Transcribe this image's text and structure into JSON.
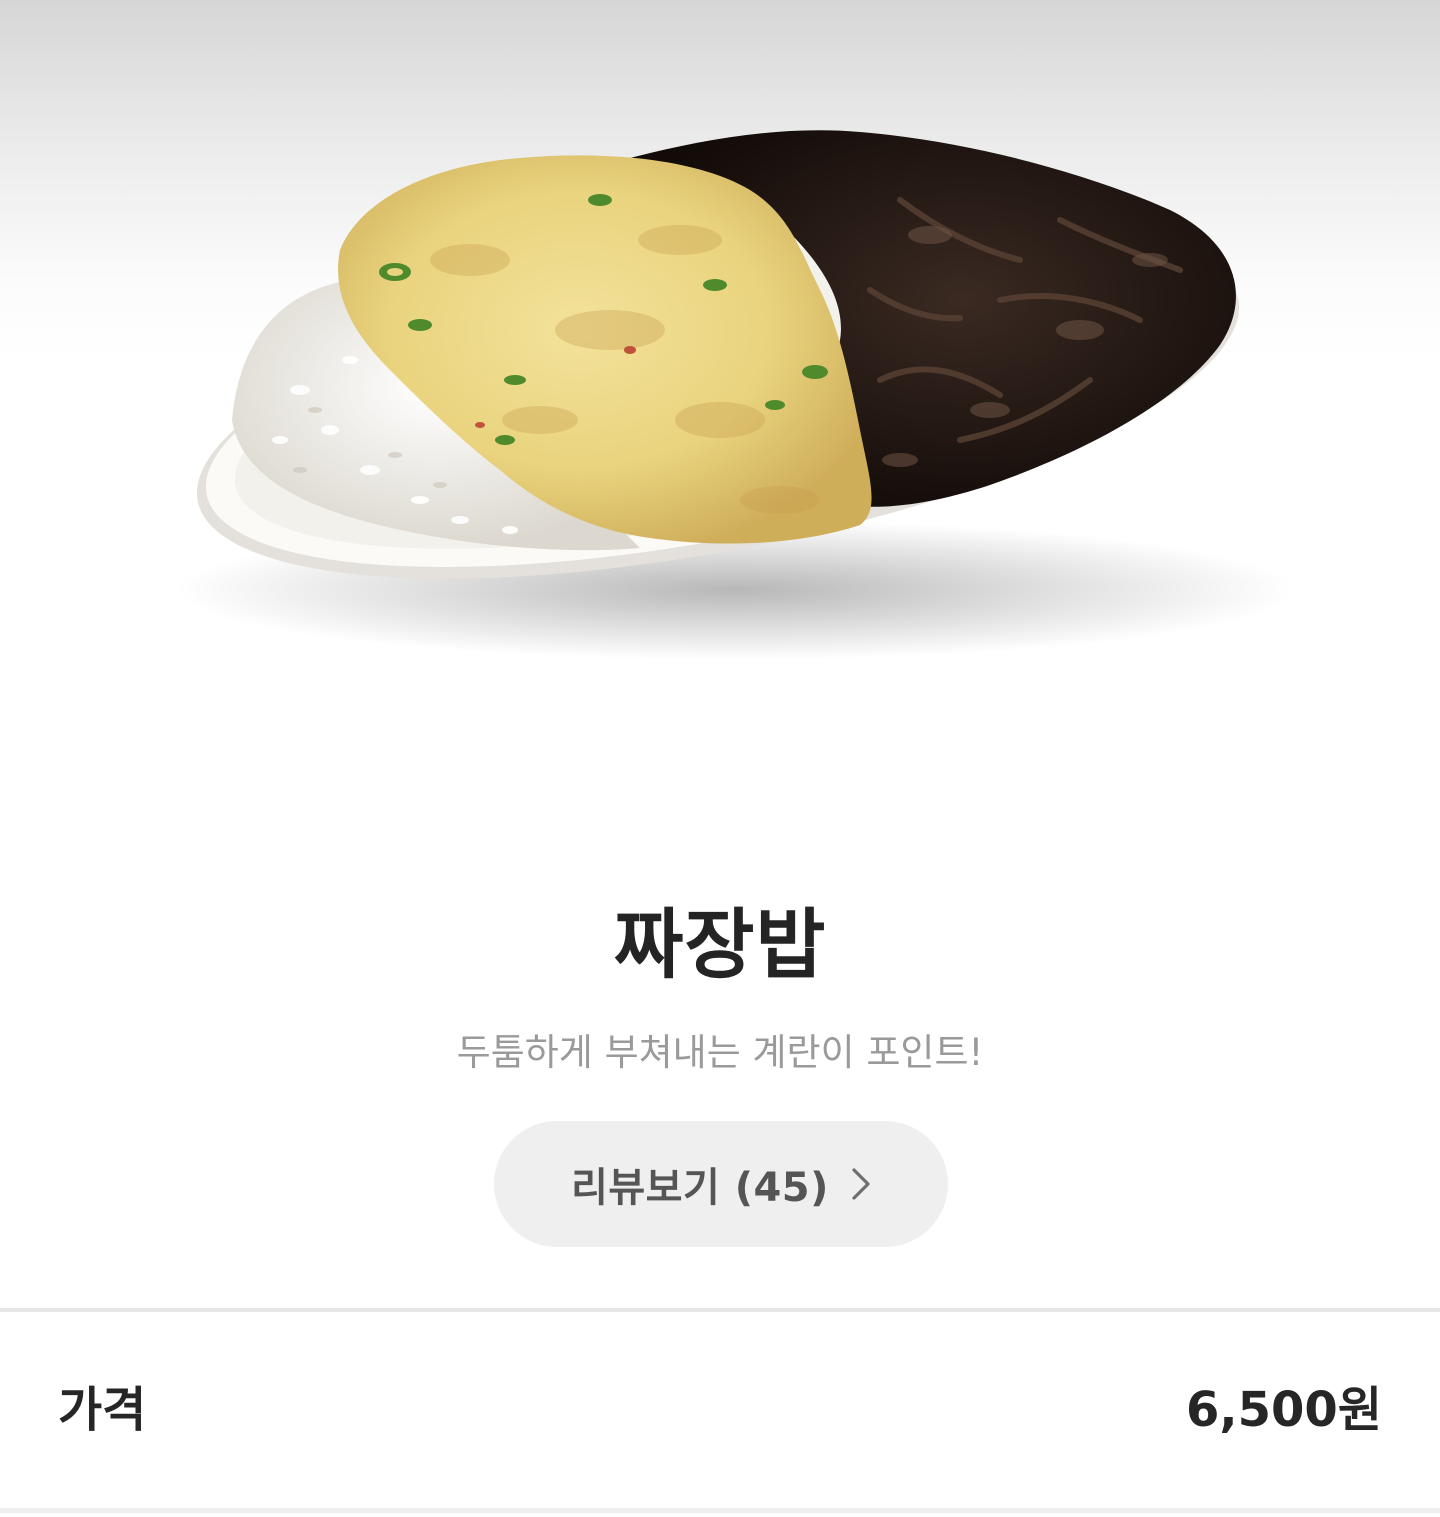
{
  "product": {
    "name": "짜장밥",
    "description": "두툼하게 부쳐내는 계란이 포인트!",
    "review_button_label": "리뷰보기 (45)"
  },
  "price": {
    "label": "가격",
    "value": "6,500원"
  },
  "icons": {
    "review_chevron": "chevron-right-icon"
  },
  "colors": {
    "review_button_bg": "#efefef",
    "divider": "#e6e6e6",
    "subtitle_text": "#9a9a9a"
  }
}
